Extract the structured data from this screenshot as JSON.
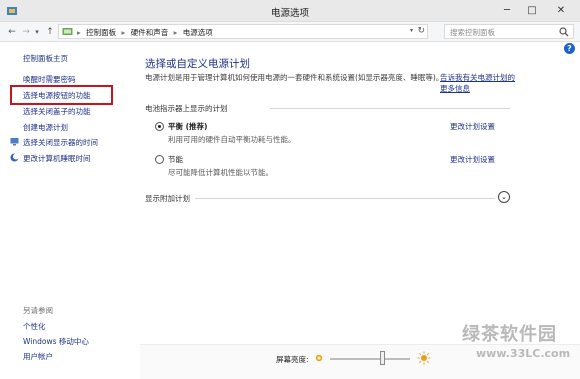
{
  "window": {
    "title": "电源选项",
    "minimize": "─",
    "maximize": "□",
    "close": "✕"
  },
  "address_bar": {
    "breadcrumbs": [
      "控制面板",
      "硬件和声音",
      "电源选项"
    ],
    "separator": "▸",
    "search_placeholder": "搜索控制面板"
  },
  "sidebar": {
    "home": "控制面板主页",
    "links": [
      "唤醒时需要密码",
      "选择电源按钮的功能",
      "选择关闭盖子的功能",
      "创建电源计划",
      "选择关闭显示器的时间",
      "更改计算机睡眠时间"
    ],
    "highlighted_index": 1,
    "see_also": {
      "header": "另请参阅",
      "items": [
        "个性化",
        "Windows 移动中心",
        "用户帐户"
      ]
    }
  },
  "main": {
    "title": "选择或自定义电源计划",
    "description": "电源计划是用于管理计算机如何使用电源的一套硬件和系统设置(如显示器亮度、睡眠等)。",
    "description_link": "告诉我有关电源计划的更多信息",
    "section_header": "电池指示器上显示的计划",
    "plans": [
      {
        "name": "平衡 (推荐)",
        "desc": "利用可用的硬件自动平衡功耗与性能。",
        "selected": true,
        "change_link": "更改计划设置"
      },
      {
        "name": "节能",
        "desc": "尽可能降低计算机性能以节能。",
        "selected": false,
        "change_link": "更改计划设置"
      }
    ],
    "extra_plans": "显示附加计划",
    "help": "?"
  },
  "bottom": {
    "brightness_label": "屏幕亮度:",
    "brightness_level": 0.65
  },
  "watermark": {
    "text": "绿茶软件园",
    "url": "www.33LC.com"
  },
  "colors": {
    "link": "#1e3287",
    "highlight_box": "#c8141e",
    "help": "#1d64c8"
  }
}
